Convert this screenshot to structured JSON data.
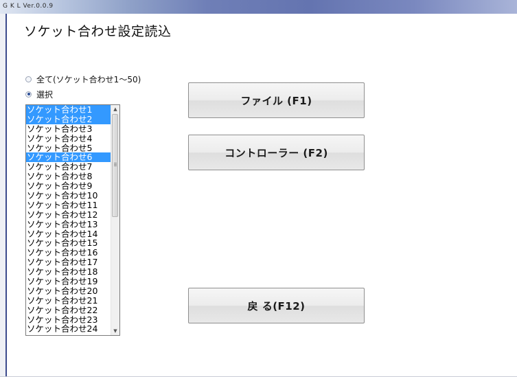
{
  "window": {
    "title": "G K L   Ver.0.0.9"
  },
  "page": {
    "title": "ソケット合わせ設定読込"
  },
  "selection": {
    "options": [
      {
        "label": "全て(ソケット合わせ1～50)",
        "checked": false
      },
      {
        "label": "選択",
        "checked": true
      }
    ]
  },
  "list": {
    "items": [
      {
        "label": "ソケット合わせ1",
        "selected": true
      },
      {
        "label": "ソケット合わせ2",
        "selected": true
      },
      {
        "label": "ソケット合わせ3",
        "selected": false
      },
      {
        "label": "ソケット合わせ4",
        "selected": false
      },
      {
        "label": "ソケット合わせ5",
        "selected": false
      },
      {
        "label": "ソケット合わせ6",
        "selected": true
      },
      {
        "label": "ソケット合わせ7",
        "selected": false
      },
      {
        "label": "ソケット合わせ8",
        "selected": false
      },
      {
        "label": "ソケット合わせ9",
        "selected": false
      },
      {
        "label": "ソケット合わせ10",
        "selected": false
      },
      {
        "label": "ソケット合わせ11",
        "selected": false
      },
      {
        "label": "ソケット合わせ12",
        "selected": false
      },
      {
        "label": "ソケット合わせ13",
        "selected": false
      },
      {
        "label": "ソケット合わせ14",
        "selected": false
      },
      {
        "label": "ソケット合わせ15",
        "selected": false
      },
      {
        "label": "ソケット合わせ16",
        "selected": false
      },
      {
        "label": "ソケット合わせ17",
        "selected": false
      },
      {
        "label": "ソケット合わせ18",
        "selected": false
      },
      {
        "label": "ソケット合わせ19",
        "selected": false
      },
      {
        "label": "ソケット合わせ20",
        "selected": false
      },
      {
        "label": "ソケット合わせ21",
        "selected": false
      },
      {
        "label": "ソケット合わせ22",
        "selected": false
      },
      {
        "label": "ソケット合わせ23",
        "selected": false
      },
      {
        "label": "ソケット合わせ24",
        "selected": false
      }
    ],
    "selected_color": "#3399ff",
    "scroll_up_icon": "up-arrow-icon",
    "scroll_down_icon": "down-arrow-icon"
  },
  "buttons": {
    "file": "ファイル (F1)",
    "controller": "コントローラー (F2)",
    "back": "戻 る(F12)"
  }
}
